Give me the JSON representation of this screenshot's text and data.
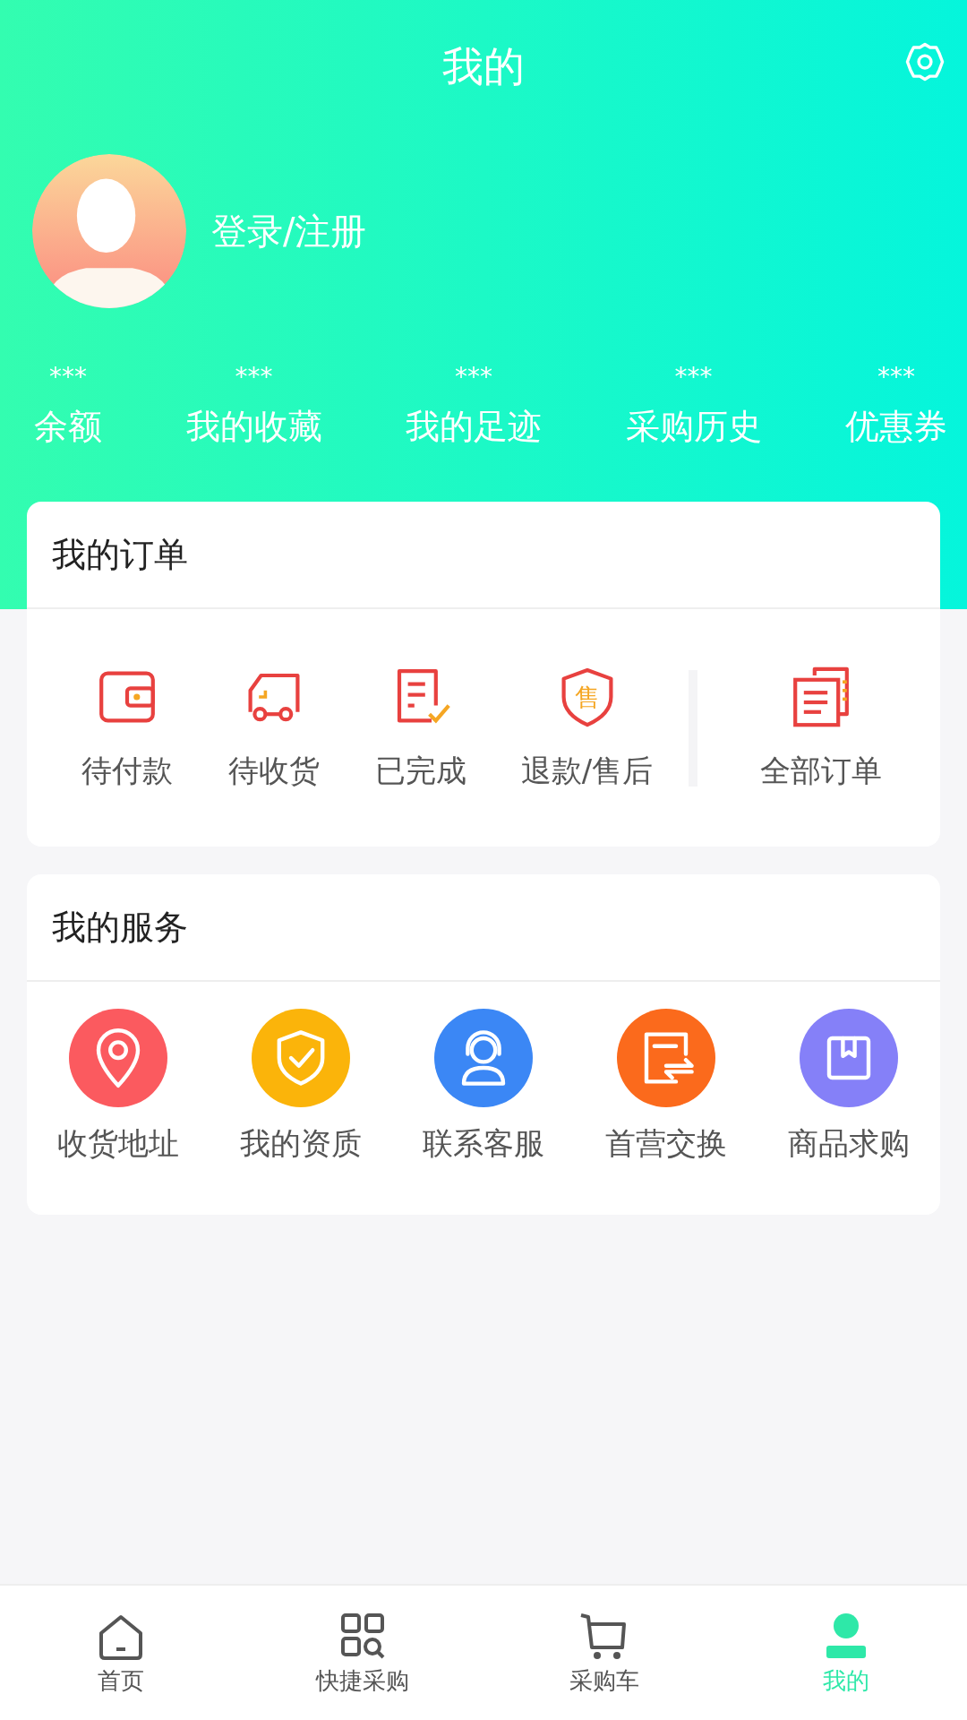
{
  "header": {
    "title": "我的",
    "login_label": "登录/注册"
  },
  "stats": [
    {
      "value": "***",
      "label": "余额"
    },
    {
      "value": "***",
      "label": "我的收藏"
    },
    {
      "value": "***",
      "label": "我的足迹"
    },
    {
      "value": "***",
      "label": "采购历史"
    },
    {
      "value": "***",
      "label": "优惠券"
    }
  ],
  "orders": {
    "title": "我的订单",
    "items": [
      {
        "kind": "wallet",
        "label": "待付款"
      },
      {
        "kind": "truck",
        "label": "待收货"
      },
      {
        "kind": "done",
        "label": "已完成"
      },
      {
        "kind": "refund",
        "label": "退款/售后",
        "icon_text": "售"
      }
    ],
    "all": {
      "kind": "all",
      "label": "全部订单"
    }
  },
  "services": {
    "title": "我的服务",
    "items": [
      {
        "kind": "pin",
        "label": "收货地址",
        "color": "#fb5a5f"
      },
      {
        "kind": "shield",
        "label": "我的资质",
        "color": "#fbb40a"
      },
      {
        "kind": "agent",
        "label": "联系客服",
        "color": "#3b87f5"
      },
      {
        "kind": "exchange",
        "label": "首营交换",
        "color": "#fb6a1c"
      },
      {
        "kind": "box",
        "label": "商品求购",
        "color": "#8580f8"
      }
    ]
  },
  "tabs": [
    {
      "kind": "home",
      "label": "首页",
      "selected": false
    },
    {
      "kind": "grid",
      "label": "快捷采购",
      "selected": false
    },
    {
      "kind": "cart",
      "label": "采购车",
      "selected": false
    },
    {
      "kind": "user",
      "label": "我的",
      "selected": true
    }
  ]
}
